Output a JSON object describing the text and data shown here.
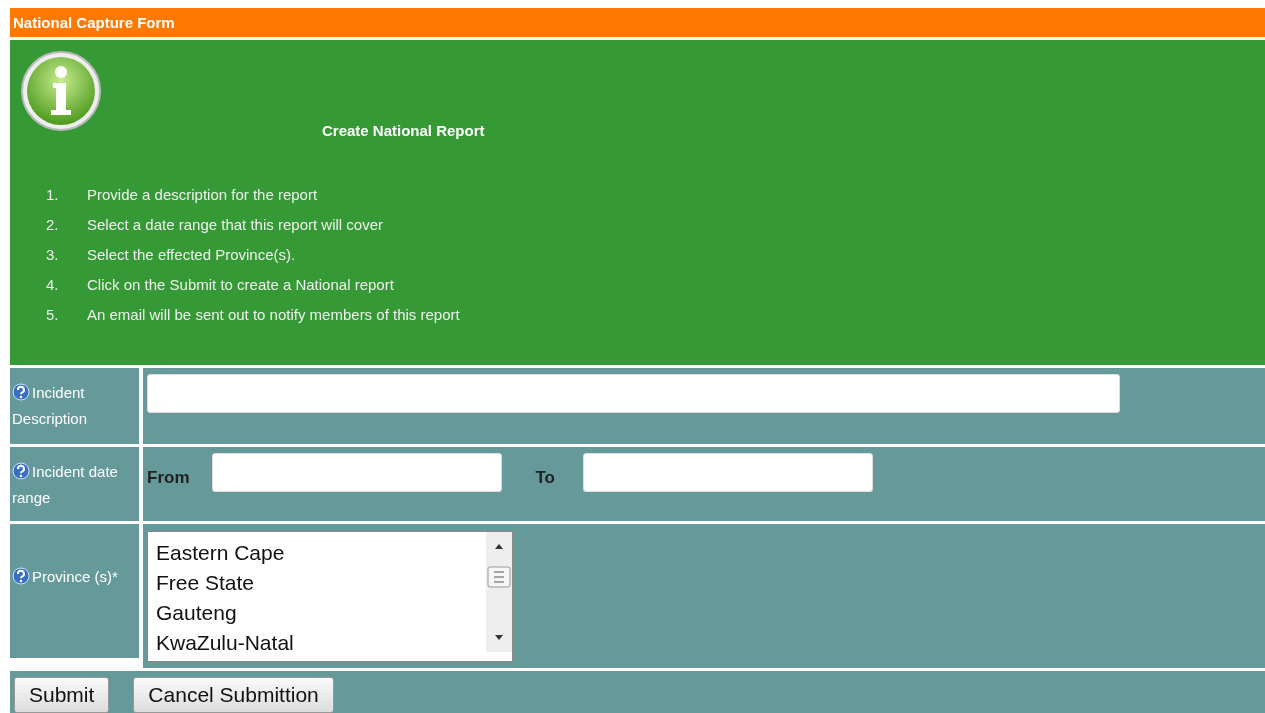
{
  "header": {
    "title": "National Capture Form"
  },
  "info": {
    "title": "Create National Report",
    "steps": [
      {
        "number": "1.",
        "text": "Provide a description for the report"
      },
      {
        "number": "2.",
        "text": "Select a date range that this report will cover"
      },
      {
        "number": "3.",
        "text": "Select the effected Province(s)."
      },
      {
        "number": "4.",
        "text": "Click on the Submit to create a National report"
      },
      {
        "number": "5.",
        "text": "An email will be sent out to notify members of this report"
      }
    ]
  },
  "fields": [
    {
      "kind": "text",
      "label": "Incident Description"
    },
    {
      "kind": "daterange",
      "label": "Incident date range",
      "from_label": "From",
      "to_label": "To"
    },
    {
      "kind": "listbox",
      "label": "Province (s)*",
      "options": [
        "Eastern Cape",
        "Free State",
        "Gauteng",
        "KwaZulu-Natal"
      ]
    }
  ],
  "buttons": [
    "Submit",
    "Cancel Submittion"
  ]
}
